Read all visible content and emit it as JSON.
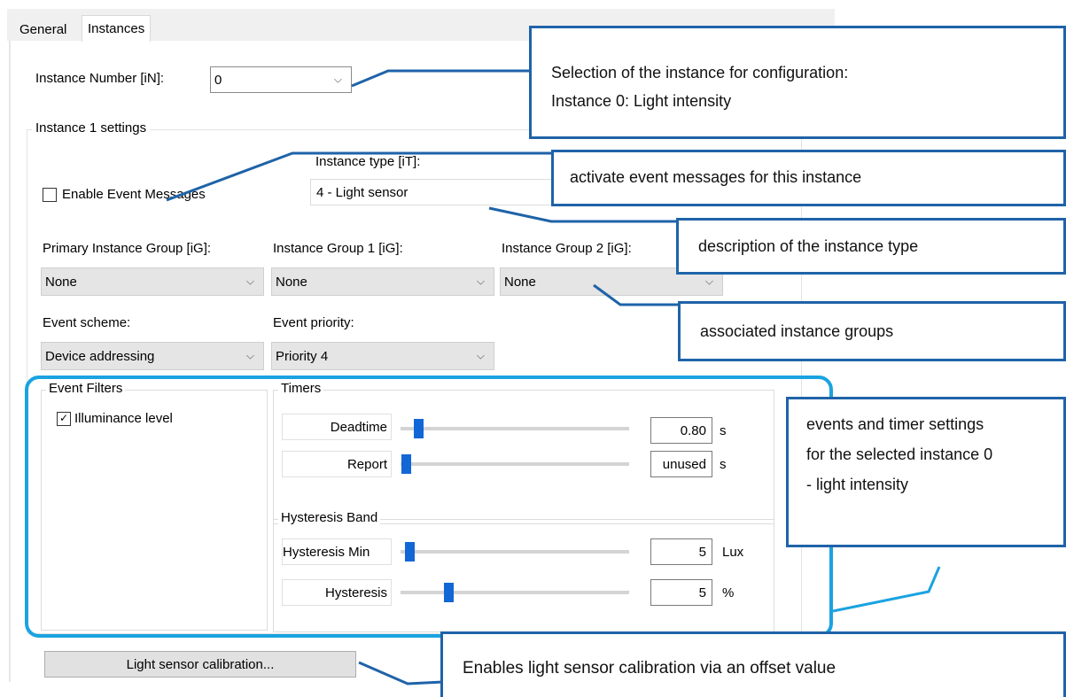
{
  "tabs": [
    {
      "label": "General"
    },
    {
      "label": "Instances"
    }
  ],
  "instance_number": {
    "label": "Instance Number [iN]:",
    "value": "0"
  },
  "instance_settings": {
    "title": "Instance 1 settings"
  },
  "enable_event_messages": {
    "label": "Enable Event Messages",
    "checked": false
  },
  "instance_type": {
    "label": "Instance type [iT]:",
    "value": "4 - Light sensor"
  },
  "primary_group": {
    "label": "Primary Instance Group [iG]:",
    "value": "None"
  },
  "group1": {
    "label": "Instance Group 1 [iG]:",
    "value": "None"
  },
  "group2": {
    "label": "Instance Group 2 [iG]:",
    "value": "None"
  },
  "event_scheme": {
    "label": "Event scheme:",
    "value": "Device addressing"
  },
  "event_priority": {
    "label": "Event priority:",
    "value": "Priority 4"
  },
  "event_filters": {
    "title": "Event Filters",
    "items": [
      {
        "label": "Illuminance level",
        "checked": true
      }
    ]
  },
  "timers": {
    "title": "Timers",
    "deadtime": {
      "label": "Deadtime",
      "value": "0.80",
      "unit": "s"
    },
    "report": {
      "label": "Report",
      "value": "unused",
      "unit": "s"
    }
  },
  "hysteresis_band": {
    "title": "Hysteresis Band",
    "min": {
      "label": "Hysteresis Min",
      "value": "5",
      "unit": "Lux"
    },
    "hysteresis": {
      "label": "Hysteresis",
      "value": "5",
      "unit": "%"
    }
  },
  "calibration_button": {
    "label": "Light sensor calibration..."
  },
  "callouts": {
    "selection_line1": "Selection of the instance for configuration:",
    "selection_line2": "Instance 0: Light intensity",
    "event_messages": "activate event messages for this instance",
    "instance_type_desc": "description of the instance type",
    "groups": "associated instance groups",
    "events_line1": "events and timer settings",
    "events_line2": "for the selected instance 0",
    "events_line3": "- light intensity",
    "calibration": "Enables light sensor calibration via an offset value"
  },
  "colors": {
    "callout_border": "#1f63a8",
    "highlight": "#1aa3e0",
    "slider_thumb": "#1167d6"
  }
}
